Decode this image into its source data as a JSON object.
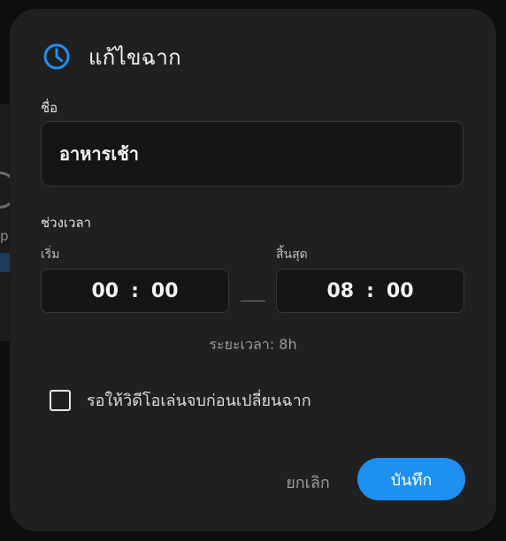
{
  "dialog": {
    "title": "แก้ไขฉาก",
    "icon": "clock-icon",
    "accent_color": "#1e90f2"
  },
  "name_field": {
    "label": "ชื่อ",
    "value": "อาหารเช้า"
  },
  "time_range": {
    "label": "ช่วงเวลา",
    "start": {
      "label": "เริ่ม",
      "hours": "00",
      "separator": ":",
      "minutes": "00"
    },
    "end": {
      "label": "สิ้นสุด",
      "hours": "08",
      "separator": ":",
      "minutes": "00"
    },
    "duration": "ระยะเวลา: 8h"
  },
  "wait_for_video": {
    "label": "รอให้วิดีโอเล่นจบก่อนเปลี่ยนฉาก",
    "checked": false
  },
  "actions": {
    "cancel_label": "ยกเลิก",
    "save_label": "บันทึก"
  },
  "background": {
    "partial_letter": "p"
  }
}
